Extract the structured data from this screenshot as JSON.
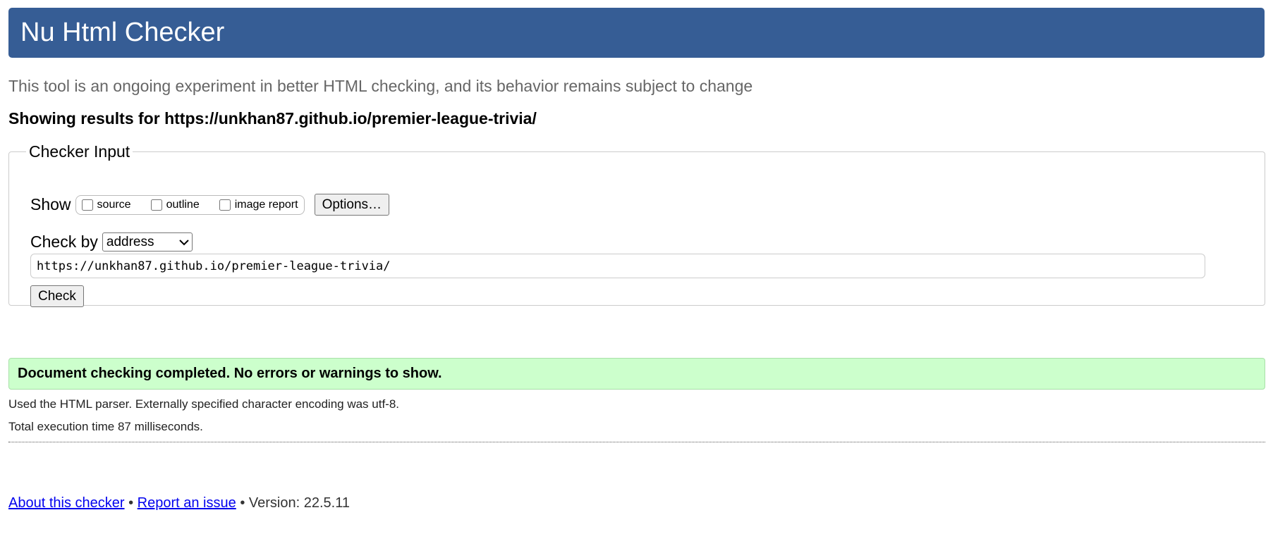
{
  "header": {
    "title": "Nu Html Checker"
  },
  "subtitle": "This tool is an ongoing experiment in better HTML checking, and its behavior remains subject to change",
  "showing_results": "Showing results for https://unkhan87.github.io/premier-league-trivia/",
  "checker_input": {
    "legend": "Checker Input",
    "show_label": "Show",
    "options": [
      {
        "label": "source",
        "checked": false
      },
      {
        "label": "outline",
        "checked": false
      },
      {
        "label": "image report",
        "checked": false
      }
    ],
    "options_button": "Options…",
    "check_by_label": "Check by",
    "check_by_selected": "address",
    "url_value": "https://unkhan87.github.io/premier-league-trivia/",
    "check_button": "Check"
  },
  "result": {
    "message": "Document checking completed. No errors or warnings to show.",
    "color": "#ccffcc"
  },
  "info": {
    "parser": "Used the HTML parser. Externally specified character encoding was utf-8.",
    "time": "Total execution time 87 milliseconds."
  },
  "footer": {
    "about_link": "About this checker",
    "separator": "•",
    "report_link": "Report an issue",
    "version": "Version: 22.5.11"
  },
  "colors": {
    "banner": "#365d95",
    "link": "#0000ee"
  }
}
